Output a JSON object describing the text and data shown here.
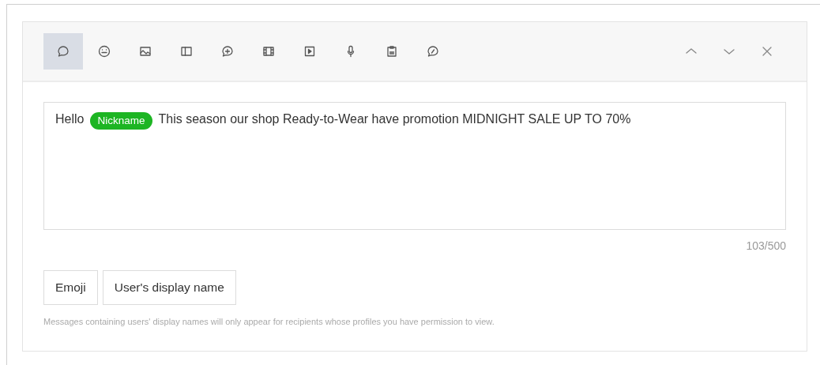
{
  "toolbar": {
    "tools": [
      {
        "kind": "bubble",
        "selected": true
      },
      {
        "kind": "smiley",
        "selected": false
      },
      {
        "kind": "image",
        "selected": false
      },
      {
        "kind": "panel",
        "selected": false
      },
      {
        "kind": "bubble-plus",
        "selected": false
      },
      {
        "kind": "film",
        "selected": false
      },
      {
        "kind": "play",
        "selected": false
      },
      {
        "kind": "mic",
        "selected": false
      },
      {
        "kind": "clipboard",
        "selected": false
      },
      {
        "kind": "bubble-pen",
        "selected": false
      }
    ],
    "actions": [
      {
        "kind": "up"
      },
      {
        "kind": "down"
      },
      {
        "kind": "close"
      }
    ]
  },
  "message": {
    "parts": [
      {
        "kind": "text",
        "text": "Hello"
      },
      {
        "kind": "tag",
        "text": "Nickname"
      },
      {
        "kind": "text",
        "text": "This season our shop Ready-to-Wear have promotion MIDNIGHT SALE UP TO 70%"
      }
    ],
    "counter": "103/500"
  },
  "buttons": [
    "Emoji",
    "User's display name"
  ],
  "note": "Messages containing users' display names will only appear for recipients whose profiles you have permission to view."
}
